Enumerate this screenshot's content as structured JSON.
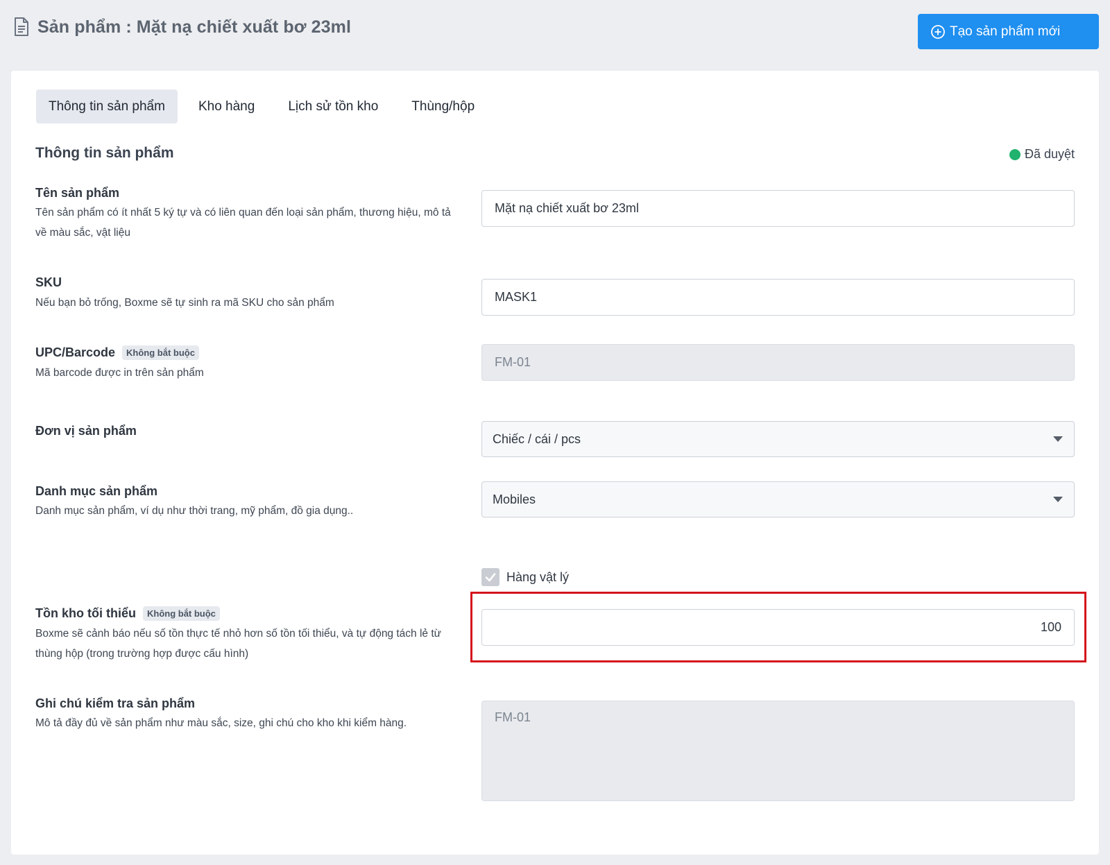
{
  "header": {
    "title": "Sản phẩm : Mặt nạ chiết xuất bơ 23ml",
    "title_icon": "document-icon",
    "create_button_label": "Tạo sản phẩm mới",
    "create_button_icon": "plus-circle-icon",
    "create_button_color": "#1f8ff0"
  },
  "tabs": [
    {
      "label": "Thông tin sản phẩm",
      "active": true
    },
    {
      "label": "Kho hàng",
      "active": false
    },
    {
      "label": "Lịch sử tồn kho",
      "active": false
    },
    {
      "label": "Thùng/hộp",
      "active": false
    }
  ],
  "section": {
    "title": "Thông tin sản phẩm",
    "status_label": "Đã duyệt",
    "status_color": "#21b26e"
  },
  "fields": {
    "name": {
      "label": "Tên sản phẩm",
      "help": "Tên sản phẩm có ít nhất 5 ký tự và có liên quan đến loại sản phẩm, thương hiệu, mô tả về màu sắc, vật liệu",
      "value": "Mặt nạ chiết xuất bơ 23ml"
    },
    "sku": {
      "label": "SKU",
      "help": "Nếu bạn bỏ trống, Boxme sẽ tự sinh ra mã SKU cho sản phẩm",
      "value": "MASK1"
    },
    "barcode": {
      "label": "UPC/Barcode",
      "badge": "Không bắt buộc",
      "help": "Mã barcode được in trên sản phẩm",
      "value": "FM-01"
    },
    "unit": {
      "label": "Đơn vị sản phẩm",
      "selected": "Chiếc / cái / pcs"
    },
    "category": {
      "label": "Danh mục sản phẩm",
      "help": "Danh mục sản phẩm, ví dụ như thời trang, mỹ phẩm, đồ gia dụng..",
      "selected": "Mobiles"
    },
    "physical": {
      "label": "Hàng vật lý",
      "checked": true
    },
    "min_stock": {
      "label": "Tồn kho tối thiểu",
      "badge": "Không bắt buộc",
      "help": "Boxme sẽ cảnh báo nếu số tồn thực tế nhỏ hơn số tồn tối thiểu, và tự động tách lẻ từ thùng hộp (trong trường hợp được cấu hình)",
      "value": "100",
      "highlight_color": "#d4141c"
    },
    "inspection_note": {
      "label": "Ghi chú kiểm tra sản phẩm",
      "help": "Mô tả đầy đủ về sản phẩm như màu sắc, size, ghi chú cho kho khi kiểm hàng.",
      "value": "FM-01"
    }
  }
}
